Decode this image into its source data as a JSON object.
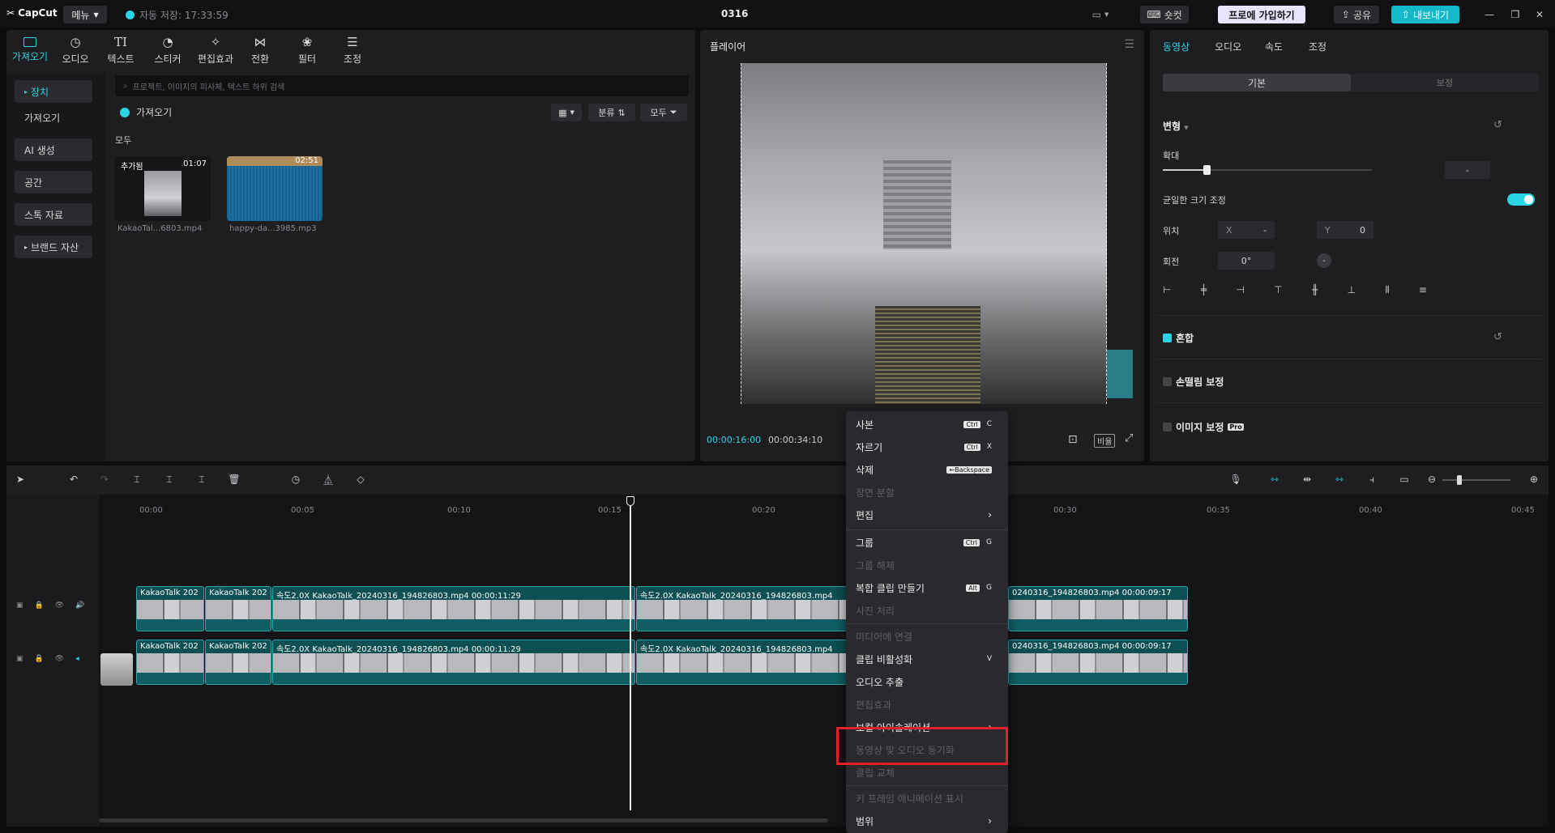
{
  "titlebar": {
    "logo": "CapCut",
    "menu_label": "메뉴",
    "autosave": "자동 저장: 17:33:59",
    "project": "0316",
    "shortcut_label": "숏컷",
    "pro_label": "프로에 가입하기",
    "share_label": "공유",
    "export_label": "내보내기"
  },
  "media": {
    "tabs": [
      {
        "label": "가져오기",
        "icon": "import-icon"
      },
      {
        "label": "오디오",
        "icon": "audio-icon"
      },
      {
        "label": "텍스트",
        "icon": "text-icon"
      },
      {
        "label": "스티커",
        "icon": "sticker-icon"
      },
      {
        "label": "편집효과",
        "icon": "effects-icon"
      },
      {
        "label": "전환",
        "icon": "transition-icon"
      },
      {
        "label": "필터",
        "icon": "filter-icon"
      },
      {
        "label": "조정",
        "icon": "adjust-icon"
      }
    ],
    "nav": [
      "장치",
      "가져오기",
      "AI 생성",
      "공간",
      "스톡 자료",
      "브랜드 자산"
    ],
    "search_placeholder": "프로젝트, 이미지의 피사체, 텍스트 하위 검색",
    "import_label": "가져오기",
    "sort_label": "분류",
    "all_filter_label": "모두",
    "section_label": "모두",
    "items": [
      {
        "name": "KakaoTal...6803.mp4",
        "badge": "추가됨",
        "duration": "01:07"
      },
      {
        "name": "happy-da...3985.mp3",
        "duration": "02:51"
      }
    ]
  },
  "player": {
    "title": "플레이어",
    "current_time": "00:00:16:00",
    "total_time": "00:00:34:10",
    "ratio_label": "비율"
  },
  "properties": {
    "tabs": [
      "동영상",
      "오디오",
      "속도",
      "조정"
    ],
    "subtabs": [
      "기본",
      "보정"
    ],
    "transform_label": "변형",
    "scale_label": "확대",
    "scale_value": "-",
    "uniform_scale_label": "균일한 크기 조정",
    "position_label": "위치",
    "x_label": "X",
    "x_value": "-",
    "y_label": "Y",
    "y_value": "0",
    "rotation_label": "회전",
    "rotation_value": "0°",
    "blend_label": "혼합",
    "stabilize_label": "손떨림 보정",
    "image_correction_label": "이미지 보정",
    "pro_badge": "Pro"
  },
  "timeline": {
    "ticks": [
      "00:00",
      "00:05",
      "00:10",
      "00:15",
      "00:20",
      "00:25",
      "00:30",
      "00:35",
      "00:40",
      "00:45"
    ],
    "clips_row1": [
      {
        "label": "KakaoTalk 202"
      },
      {
        "label": "KakaoTalk 202"
      },
      {
        "label": "속도2.0X  KakaoTalk_20240316_194826803.mp4  00:00:11:29"
      },
      {
        "label": "속도2.0X  KakaoTalk_20240316_194826803.mp4"
      },
      {
        "label": "0240316_194826803.mp4  00:00:09:17"
      }
    ],
    "clips_row2": [
      {
        "label": "KakaoTalk 202"
      },
      {
        "label": "KakaoTalk 202"
      },
      {
        "label": "속도2.0X  KakaoTalk_20240316_194826803.mp4  00:00:11:29"
      },
      {
        "label": "속도2.0X  KakaoTalk_20240316_194826803.mp4"
      },
      {
        "label": "0240316_194826803.mp4  00:00:09:17"
      }
    ]
  },
  "context_menu": {
    "items": [
      {
        "label": "사본",
        "key1": "Ctrl",
        "key2": "C",
        "disabled": false
      },
      {
        "label": "자르기",
        "key1": "Ctrl",
        "key2": "X",
        "disabled": false
      },
      {
        "label": "삭제",
        "key1": "←Backspace",
        "disabled": false
      },
      {
        "label": "장면 분할",
        "disabled": true
      },
      {
        "label": "편집",
        "disabled": false
      },
      {
        "label": "그룹",
        "key1": "Ctrl",
        "key2": "G",
        "disabled": false
      },
      {
        "label": "그룹 해제",
        "disabled": true
      },
      {
        "label": "복합 클립 만들기",
        "key1": "Alt",
        "key2": "G",
        "disabled": false
      },
      {
        "label": "사진 처리",
        "disabled": true
      },
      {
        "label": "미디어에 연결",
        "disabled": true
      },
      {
        "label": "클립 비활성화",
        "key2": "V",
        "disabled": false
      },
      {
        "label": "오디오 추출",
        "disabled": false
      },
      {
        "label": "편집효과",
        "disabled": true
      },
      {
        "label": "보컬 아이솔레이션",
        "disabled": false
      },
      {
        "label": "동영상 및 오디오 동기화",
        "disabled": true
      },
      {
        "label": "클립 교체",
        "disabled": true
      },
      {
        "label": "키 프레임 애니메이션 표시",
        "disabled": true
      },
      {
        "label": "범위",
        "disabled": false
      }
    ]
  },
  "colors": {
    "accent": "#2cd5e6",
    "highlight": "#e0202a",
    "clip": "#0d4f52"
  }
}
